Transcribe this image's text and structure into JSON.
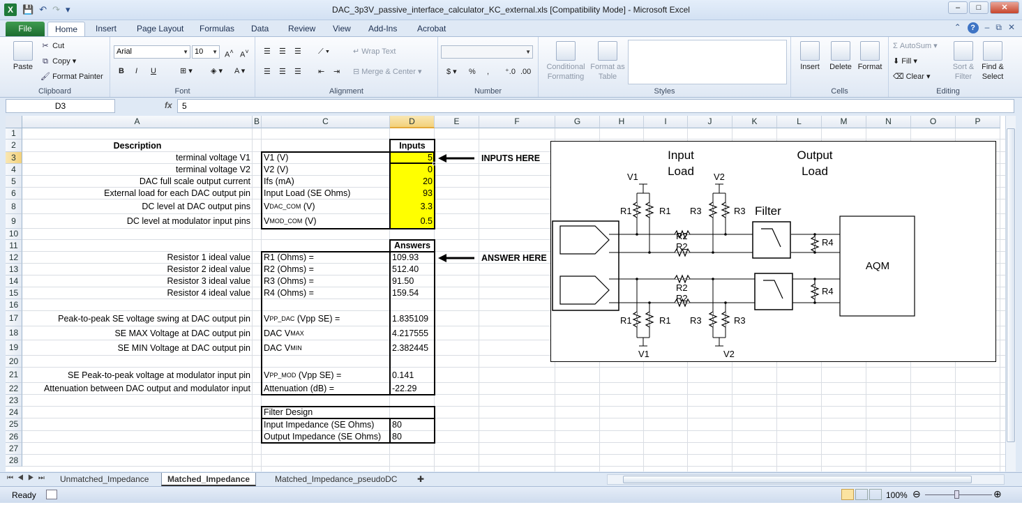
{
  "window": {
    "title": "DAC_3p3V_passive_interface_calculator_KC_external.xls  [Compatibility Mode]  -  Microsoft Excel",
    "app_icon": "X",
    "controls": {
      "minimize": "–",
      "maximize": "□",
      "close": "✕"
    }
  },
  "ribbon_tabs": [
    "File",
    "Home",
    "Insert",
    "Page Layout",
    "Formulas",
    "Data",
    "Review",
    "View",
    "Add-Ins",
    "Acrobat"
  ],
  "ribbon": {
    "clipboard": {
      "paste": "Paste",
      "cut": "Cut",
      "copy": "Copy",
      "format_painter": "Format Painter",
      "label": "Clipboard"
    },
    "font": {
      "name": "Arial",
      "size": "10",
      "label": "Font",
      "bold": "B",
      "italic": "I",
      "underline": "U"
    },
    "alignment": {
      "wrap": "Wrap Text",
      "merge": "Merge & Center",
      "label": "Alignment"
    },
    "number": {
      "label": "Number",
      "currency": "$",
      "percent": "%",
      "comma": ","
    },
    "styles": {
      "conditional": "Conditional Formatting",
      "format_table": "Format as Table",
      "label": "Styles"
    },
    "cells": {
      "insert": "Insert",
      "delete": "Delete",
      "format": "Format",
      "label": "Cells"
    },
    "editing": {
      "autosum": "AutoSum",
      "fill": "Fill",
      "clear": "Clear",
      "sort": "Sort & Filter",
      "find": "Find & Select",
      "label": "Editing"
    }
  },
  "formula_bar": {
    "name_box": "D3",
    "fx": "fx",
    "value": "5"
  },
  "columns": [
    "A",
    "B",
    "C",
    "D",
    "E",
    "F",
    "G",
    "H",
    "I",
    "J",
    "K",
    "L",
    "M",
    "N",
    "O",
    "P"
  ],
  "rows": [
    "1",
    "2",
    "3",
    "4",
    "5",
    "6",
    "8",
    "9",
    "10",
    "11",
    "12",
    "13",
    "14",
    "15",
    "16",
    "17",
    "18",
    "19",
    "20",
    "21",
    "22",
    "23",
    "24",
    "25",
    "26",
    "27",
    "28"
  ],
  "sheet": {
    "description_header": "Description",
    "inputs_header": "Inputs",
    "answers_header": "Answers",
    "inputs_arrow": "INPUTS HERE",
    "answers_arrow": "ANSWER HERE",
    "input_rows": [
      {
        "desc": "terminal voltage V1",
        "label": "V1 (V)",
        "value": "5"
      },
      {
        "desc": "terminal voltage V2",
        "label": "V2 (V)",
        "value": "0"
      },
      {
        "desc": "DAC full scale output current",
        "label": "Ifs (mA)",
        "value": "20"
      },
      {
        "desc": "External load for each DAC output pin",
        "label": "Input Load (SE Ohms)",
        "value": "93"
      },
      {
        "desc": "DC level at DAC output pins",
        "label": "V",
        "sub": "DAC_COM",
        "tail": " (V)",
        "value": "3.3"
      },
      {
        "desc": "DC level at modulator input pins",
        "label": "V",
        "sub": "MOD_COM",
        "tail": " (V)",
        "value": "0.5"
      }
    ],
    "answer_rows": [
      {
        "desc": "Resistor 1 ideal value",
        "label": "R1 (Ohms) =",
        "value": "109.93"
      },
      {
        "desc": "Resistor 2 ideal value",
        "label": "R2 (Ohms) =",
        "value": "512.40"
      },
      {
        "desc": "Resistor 3 ideal value",
        "label": "R3 (Ohms) =",
        "value": "91.50"
      },
      {
        "desc": "Resistor 4 ideal value",
        "label": "R4 (Ohms) =",
        "value": "159.54"
      },
      {
        "desc": "Peak-to-peak SE voltage swing at DAC output pin",
        "label": "V",
        "sub": "PP_DAC",
        "tail": " (Vpp SE) =",
        "value": "1.835109"
      },
      {
        "desc": "SE MAX Voltage at DAC output pin",
        "label": "DAC V",
        "sub": "MAX",
        "tail": "",
        "value": "4.217555"
      },
      {
        "desc": "SE MIN Voltage at DAC output pin",
        "label": "DAC V",
        "sub": "MIN",
        "tail": "",
        "value": "2.382445"
      },
      {
        "desc": "SE Peak-to-peak voltage at modulator input pin",
        "label": "V",
        "sub": "PP_MOD",
        "tail": " (Vpp SE) =",
        "value": "0.141"
      },
      {
        "desc": "Attenuation between DAC output and modulator input",
        "label": "Attenuation (dB) =",
        "value": "-22.29"
      }
    ],
    "filter_design": {
      "title": "Filter Design",
      "rows": [
        {
          "label": "Input Impedance (SE Ohms)",
          "value": "80"
        },
        {
          "label": "Output Impedance (SE Ohms)",
          "value": "80"
        }
      ]
    }
  },
  "diagram": {
    "input_load": [
      "Input",
      "Load"
    ],
    "output_load": [
      "Output",
      "Load"
    ],
    "filter": "Filter",
    "aqm": "AQM",
    "labels": {
      "r1": "R1",
      "r2": "R2",
      "r3": "R3",
      "r4": "R4",
      "v1": "V1",
      "v2": "V2"
    }
  },
  "sheet_tabs": [
    "Unmatched_Impedance",
    "Matched_Impedance",
    "Matched_Impedance_pseudoDC"
  ],
  "active_sheet": "Matched_Impedance",
  "status": {
    "ready": "Ready",
    "zoom": "100%"
  }
}
